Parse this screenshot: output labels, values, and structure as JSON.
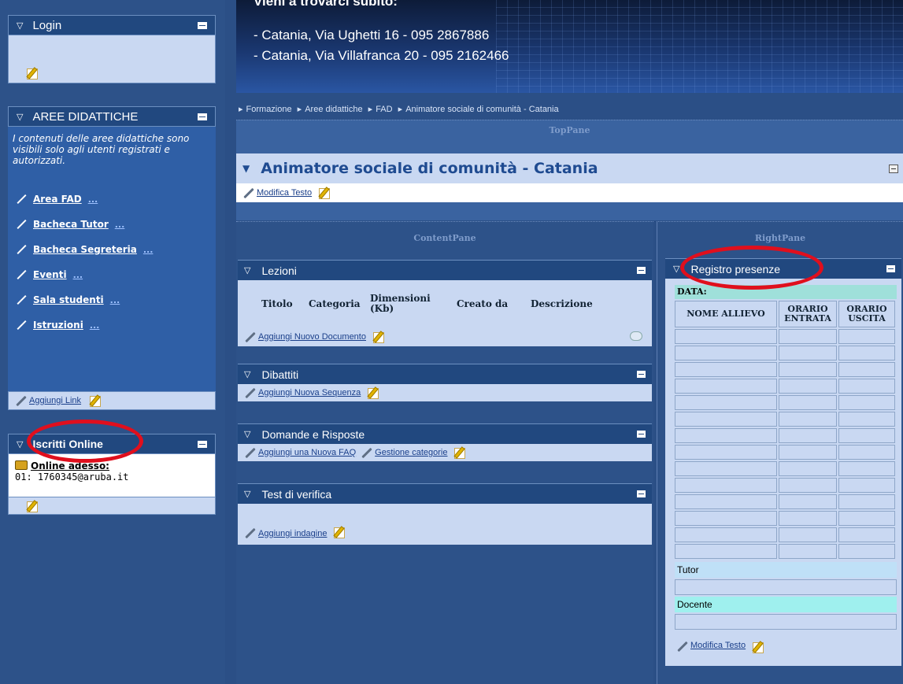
{
  "banner": {
    "cut_line": "Vieni a trovarci subito:",
    "address_1": "- Catania, Via Ughetti 16 - 095 2867886",
    "address_2": "- Catania, Via Villafranca 20 - 095 2162466"
  },
  "breadcrumb": [
    "Formazione",
    "Aree didattiche",
    "FAD",
    "Animatore sociale di comunità - Catania"
  ],
  "left": {
    "login": {
      "title": "Login"
    },
    "aree": {
      "title": "AREE DIDATTICHE",
      "note": "I contenuti delle aree didattiche sono visibili solo agli utenti registrati e autorizzati.",
      "links": [
        "Area FAD",
        "Bacheca Tutor",
        "Bacheca Segreteria",
        "Eventi",
        "Sala studenti",
        "Istruzioni"
      ],
      "more": "...",
      "add_link": "Aggiungi Link"
    },
    "iscritti": {
      "title": "Iscritti Online",
      "online_label": "Online adesso:",
      "user_line": "01: 1760345@aruba.it"
    }
  },
  "toppane": {
    "label": "TopPane",
    "module_title": "Animatore sociale di comunità - Catania",
    "edit_text": "Modifica Testo"
  },
  "contentpane": {
    "label": "ContentPane",
    "lezioni": {
      "title": "Lezioni",
      "columns": [
        "Titolo",
        "Categoria",
        "Dimensioni (Kb)",
        "Creato da",
        "Descrizione"
      ],
      "add": "Aggiungi Nuovo Documento"
    },
    "dibattiti": {
      "title": "Dibattiti",
      "add": "Aggiungi Nuova Sequenza"
    },
    "faq": {
      "title": "Domande e Risposte",
      "add": "Aggiungi una Nuova FAQ",
      "manage": "Gestione categorie"
    },
    "test": {
      "title": "Test di verifica",
      "add": "Aggiungi indagine"
    }
  },
  "rightpane": {
    "label": "RightPane",
    "registro": {
      "title": "Registro presenze",
      "data_label": "DATA:",
      "col_nome": "NOME ALLIEVO",
      "col_entrata": "ORARIO ENTRATA",
      "col_uscita": "ORARIO USCITA",
      "rows": 14,
      "tutor": "Tutor",
      "docente": "Docente",
      "edit_text": "Modifica Testo"
    }
  },
  "colors": {
    "highlight": "#e00f1d",
    "panel_header": "#21487f",
    "panel_body": "#c9d8f2",
    "page_bg": "#2b4f86"
  }
}
